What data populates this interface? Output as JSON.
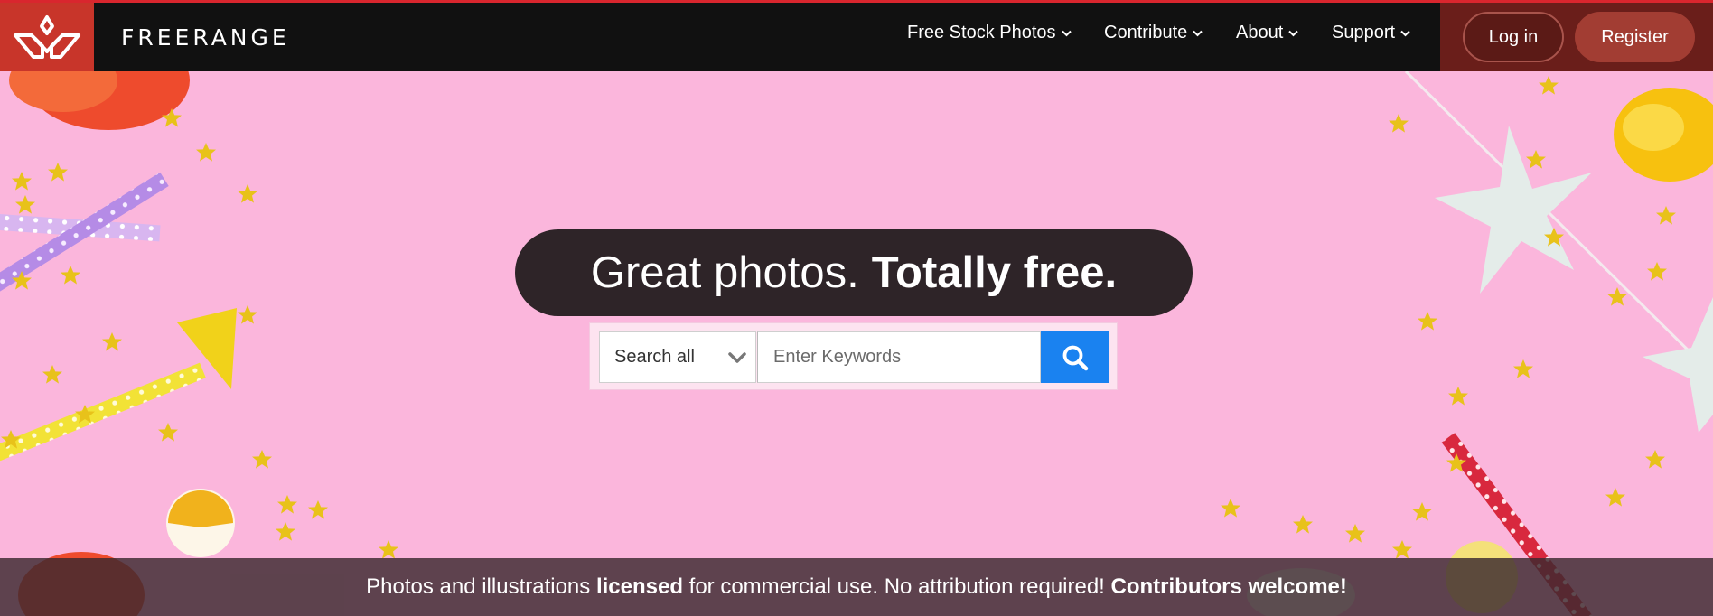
{
  "brand": {
    "name": "FREERANGE",
    "logo_icon": "freerange-leaf-logo"
  },
  "nav": {
    "items": [
      {
        "label": "Free Stock Photos"
      },
      {
        "label": "Contribute"
      },
      {
        "label": "About"
      },
      {
        "label": "Support"
      }
    ],
    "login_label": "Log in",
    "register_label": "Register"
  },
  "hero": {
    "headline_regular": "Great photos.",
    "headline_bold": "Totally free.",
    "search": {
      "scope_selected": "Search all",
      "placeholder": "Enter Keywords",
      "button_icon": "search-icon"
    },
    "banner": {
      "part1": "Photos and illustrations ",
      "part2": "licensed",
      "part3": " for commercial use. No attribution required! ",
      "part4": "Contributors welcome!"
    }
  },
  "colors": {
    "nav_bg": "#111111",
    "logo_bg": "#c8352a",
    "auth_bg": "#6a1e1a",
    "hero_bg": "#fbb6dc",
    "search_button": "#1a82f0",
    "headline_bg": "#2e2428"
  }
}
